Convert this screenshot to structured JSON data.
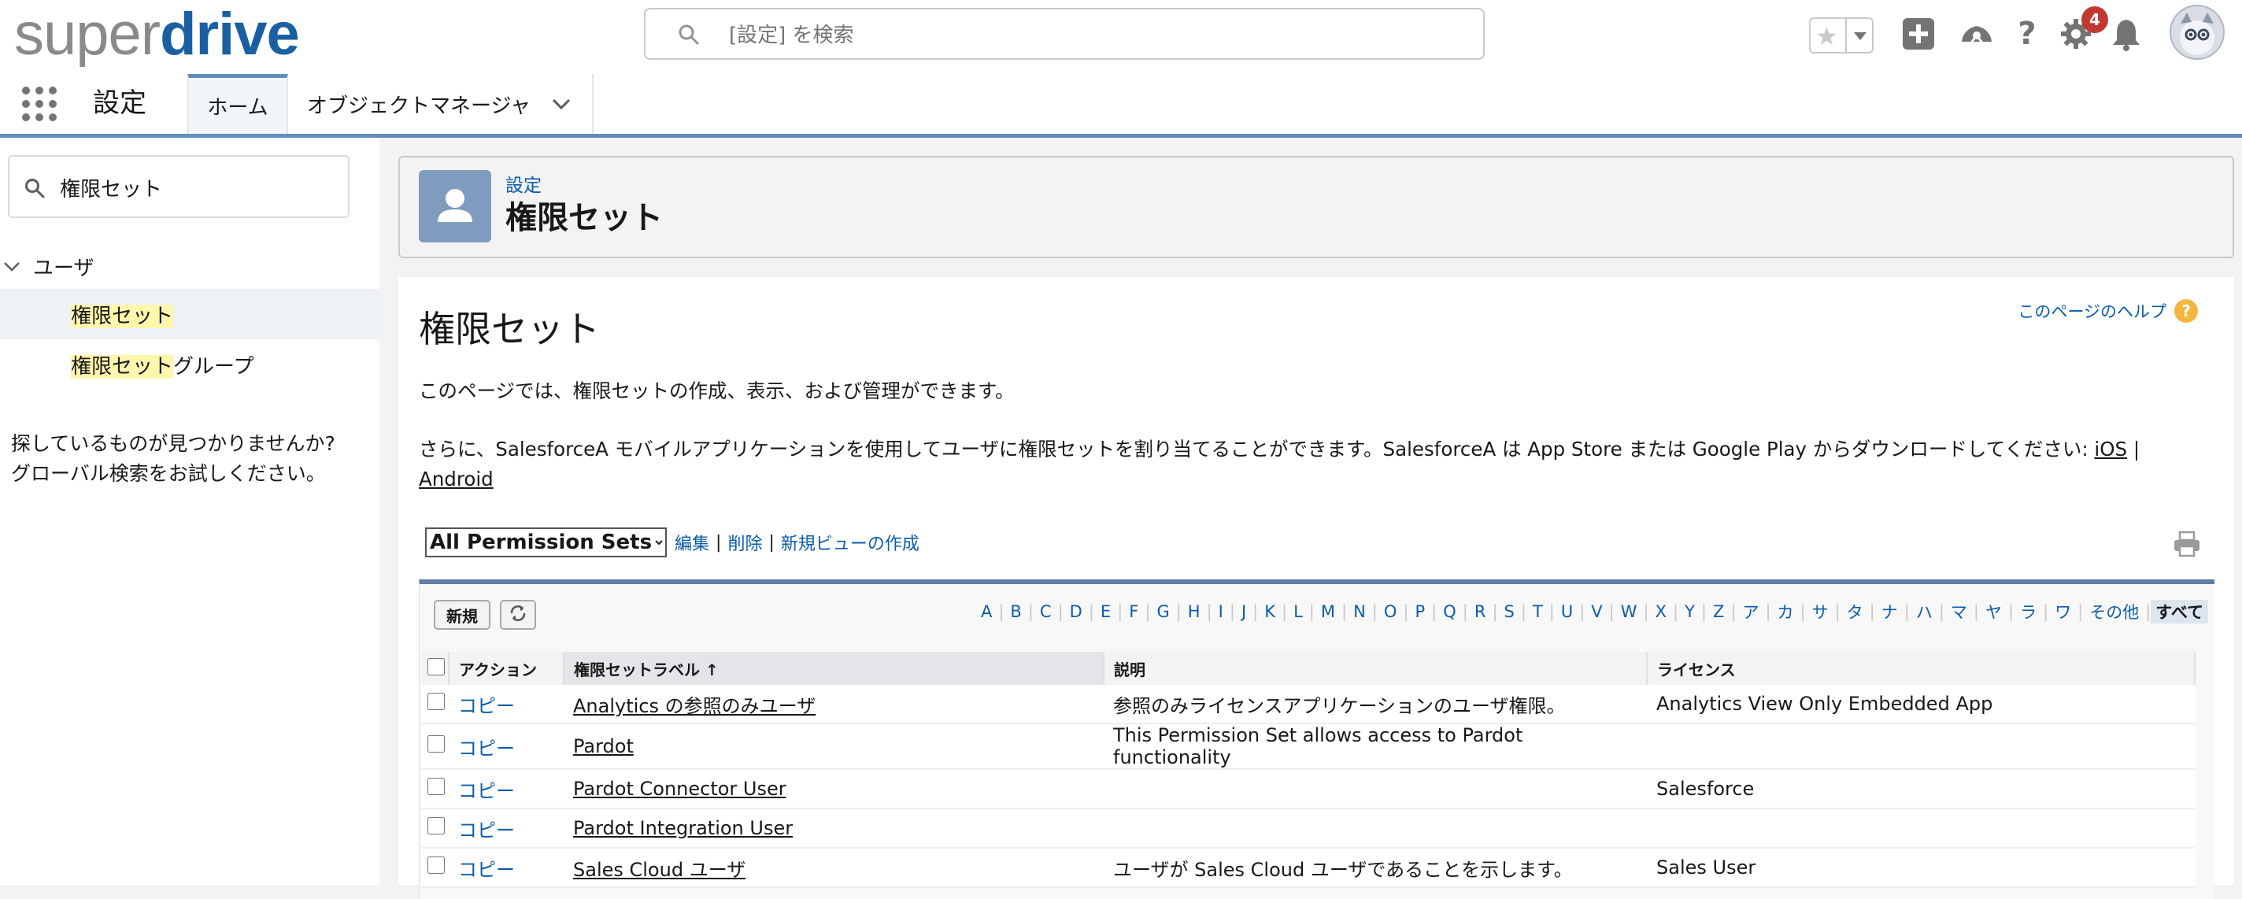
{
  "header": {
    "logo_part1": "super",
    "logo_part2": "drive",
    "search_placeholder": "[設定] を検索",
    "notification_count": "4"
  },
  "context": {
    "app_name": "設定",
    "tabs": [
      {
        "label": "ホーム"
      },
      {
        "label": "オブジェクトマネージャ"
      }
    ]
  },
  "sidebar": {
    "quickfind_value": "権限セット",
    "section": "ユーザ",
    "items": [
      {
        "hl": "権限セット",
        "rest": ""
      },
      {
        "hl": "権限セット",
        "rest": "グループ"
      }
    ],
    "notfound_line1": "探しているものが見つかりませんか?",
    "notfound_line2": "グローバル検索をお試しください。"
  },
  "page_header": {
    "breadcrumb": "設定",
    "title": "権限セット"
  },
  "main": {
    "title": "権限セット",
    "help": "このページのヘルプ",
    "desc1": "このページでは、権限セットの作成、表示、および管理ができます。",
    "desc2_text": "さらに、SalesforceA モバイルアプリケーションを使用してユーザに権限セットを割り当てることができます。SalesforceA は App Store または Google Play からダウンロードしてください: ",
    "ios_link": "iOS",
    "sep": " | ",
    "android_link": "Android",
    "view_selected": "All Permission Sets",
    "edit": "編集",
    "delete": "削除",
    "new_view": "新規ビューの作成",
    "new_button": "新規"
  },
  "alpha_filter": [
    "A",
    "B",
    "C",
    "D",
    "E",
    "F",
    "G",
    "H",
    "I",
    "J",
    "K",
    "L",
    "M",
    "N",
    "O",
    "P",
    "Q",
    "R",
    "S",
    "T",
    "U",
    "V",
    "W",
    "X",
    "Y",
    "Z",
    "ア",
    "カ",
    "サ",
    "タ",
    "ナ",
    "ハ",
    "マ",
    "ヤ",
    "ラ",
    "ワ",
    "その他"
  ],
  "alpha_current": "すべて",
  "table": {
    "columns": [
      "アクション",
      "権限セットラベル ↑",
      "説明",
      "ライセンス"
    ],
    "rows": [
      {
        "action": "コピー",
        "label": "Analytics の参照のみユーザ",
        "desc": "参照のみライセンスアプリケーションのユーザ権限。",
        "license": "Analytics View Only Embedded App"
      },
      {
        "action": "コピー",
        "label": "Pardot",
        "desc": "This Permission Set allows access to Pardot functionality",
        "license": ""
      },
      {
        "action": "コピー",
        "label": "Pardot Connector User",
        "desc": "",
        "license": "Salesforce"
      },
      {
        "action": "コピー",
        "label": "Pardot Integration User",
        "desc": "",
        "license": ""
      },
      {
        "action": "コピー",
        "label": "Sales Cloud ユーザ",
        "desc": "ユーザが Sales Cloud ユーザであることを示します。",
        "license": "Sales User"
      }
    ]
  }
}
